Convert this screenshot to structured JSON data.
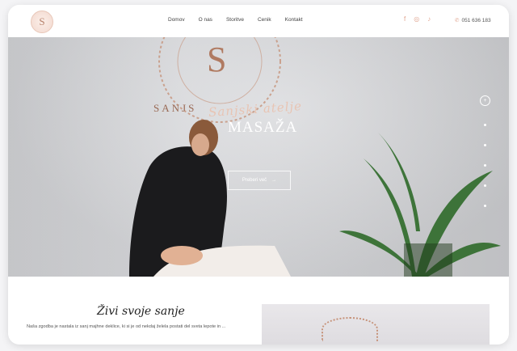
{
  "header": {
    "logo_letter": "S",
    "nav": [
      "Domov",
      "O nas",
      "Storitve",
      "Cenik",
      "Kontakt"
    ],
    "phone": "051 636 183",
    "social_icons": [
      "facebook-icon",
      "instagram-icon",
      "tiktok-icon"
    ]
  },
  "hero": {
    "script_title": "Sanjski atelje",
    "title": "MASAŽA",
    "button_label": "Preberi več",
    "slide_count": 5
  },
  "section": {
    "script_title": "Živi svoje sanje",
    "text": "Naša zgodba je nastala iz sanj majhne deklice, ki si je od nekdaj želela postati del sveta lepote in ..."
  },
  "colors": {
    "accent": "#e0a48f",
    "logo_brown": "#b9846e"
  }
}
